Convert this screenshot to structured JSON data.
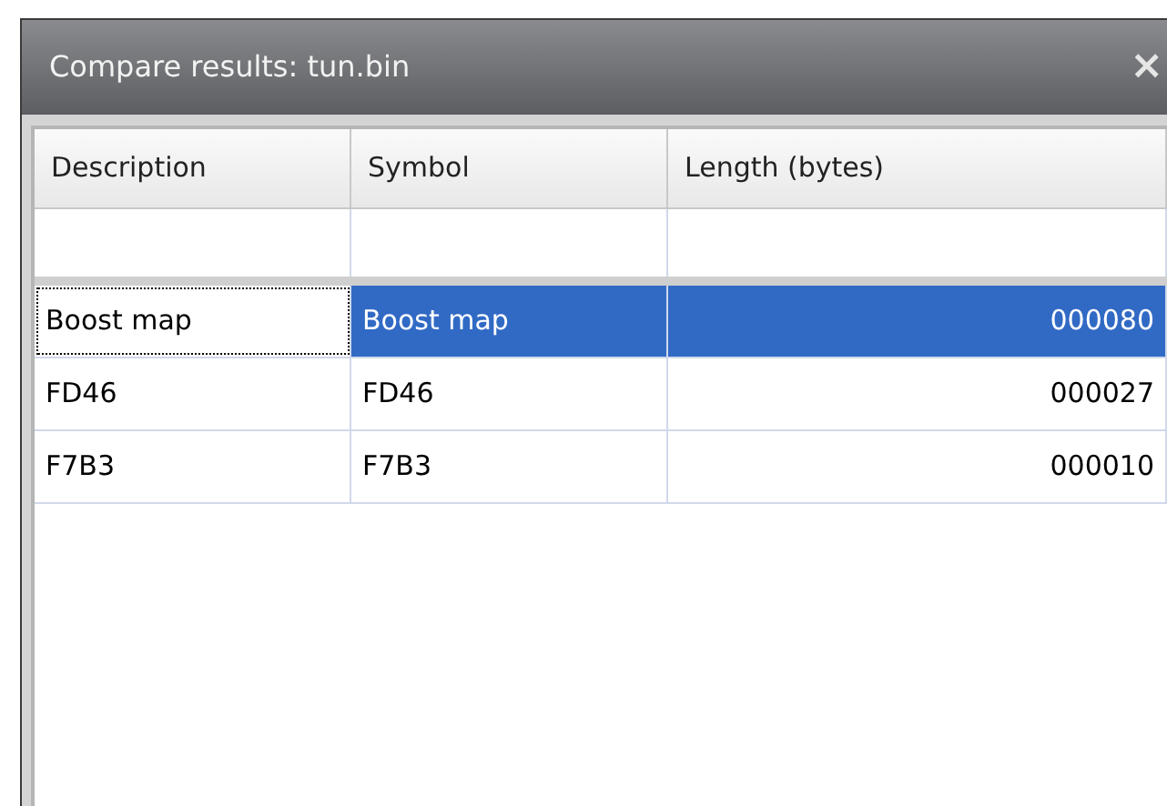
{
  "window": {
    "title": "Compare results: tun.bin",
    "close": "×"
  },
  "table": {
    "columns": [
      "Description",
      "Symbol",
      "Length (bytes)"
    ],
    "rows": [
      {
        "cells": [
          "Boost map",
          "Boost map",
          "000080"
        ],
        "selected": true,
        "focused": true
      },
      {
        "cells": [
          "FD46",
          "FD46",
          "000027"
        ],
        "selected": false,
        "focused": false
      },
      {
        "cells": [
          "F7B3",
          "F7B3",
          "000010"
        ],
        "selected": false,
        "focused": false
      }
    ]
  }
}
